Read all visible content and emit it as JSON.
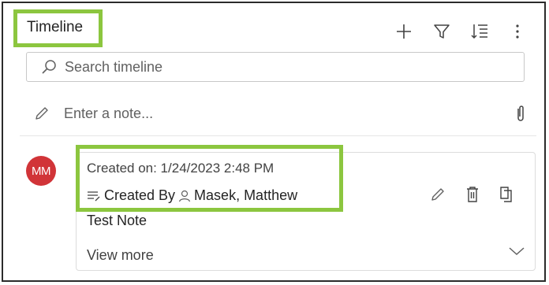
{
  "header": {
    "title": "Timeline",
    "actions": [
      {
        "icon": "plus-icon"
      },
      {
        "icon": "filter-icon"
      },
      {
        "icon": "sort-icon"
      },
      {
        "icon": "more-vertical-icon"
      }
    ]
  },
  "search": {
    "placeholder": "Search timeline",
    "icon": "search-icon"
  },
  "note": {
    "placeholder": "Enter a note...",
    "icon": "pencil-icon",
    "attach_icon": "paperclip-icon"
  },
  "record": {
    "avatar_initials": "MM",
    "avatar_color": "#d13438",
    "created_on": "Created on: 1/24/2023 2:48 PM",
    "created_by_label": "Created By",
    "created_by_name": "Masek, Matthew",
    "title": "Test Note",
    "view_more": "View more",
    "actions": [
      {
        "icon": "edit-icon"
      },
      {
        "icon": "delete-icon"
      },
      {
        "icon": "copy-icon"
      }
    ]
  },
  "colors": {
    "highlight": "#8cc63f",
    "border": "#2b2b2b"
  }
}
